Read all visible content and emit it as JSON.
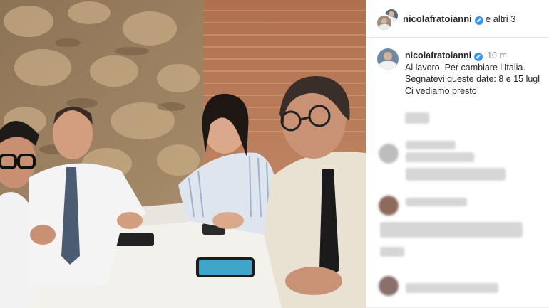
{
  "post": {
    "header_username": "nicolafratoianni",
    "header_others": "e altri 3",
    "verified_icon": "✔",
    "caption_username": "nicolafratoianni",
    "timestamp": "10 m",
    "caption_lines": [
      "Al lavoro. Per cambiare l’Italia.",
      "Segnatevi queste date: 8 e 15 lugl",
      "Ci vediamo presto!"
    ]
  },
  "icons": {
    "verified": "verified-badge-icon",
    "avatar": "profile-avatar-icon"
  },
  "colors": {
    "verified": "#3897f0",
    "text": "#262626",
    "muted": "#8e8e8e"
  }
}
